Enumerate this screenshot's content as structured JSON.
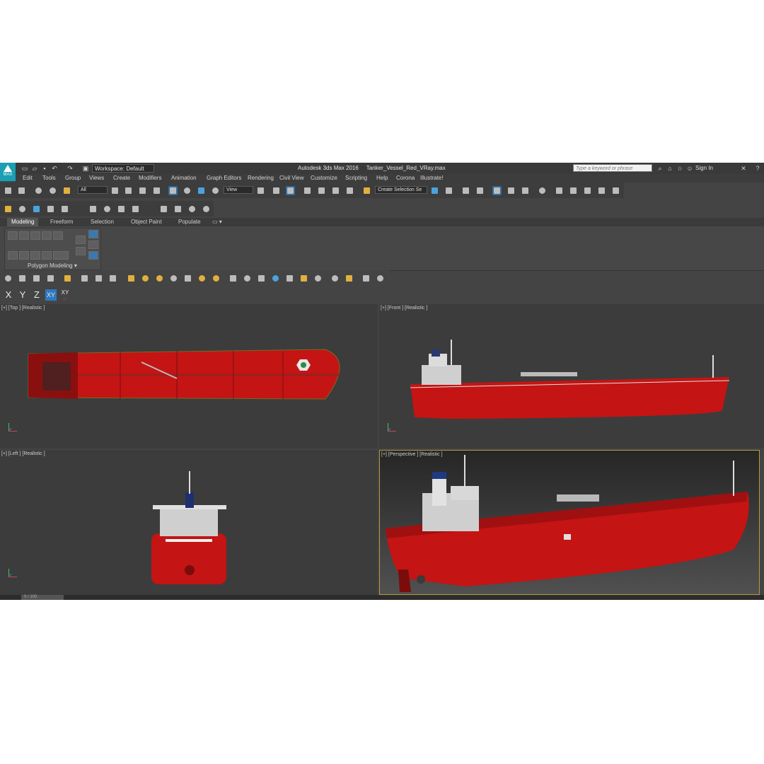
{
  "titlebar": {
    "logo_text": "MAX",
    "workspace": "Workspace: Default",
    "app_title": "Autodesk 3ds Max 2016     Tanker_Vessel_Red_VRay.max",
    "search_placeholder": "Type a keyword or phrase",
    "sign_in": "Sign In"
  },
  "menu": [
    "Edit",
    "Tools",
    "Group",
    "Views",
    "Create",
    "Modifiers",
    "Animation",
    "Graph Editors",
    "Rendering",
    "Civil View",
    "Customize",
    "Scripting",
    "Help",
    "Corona",
    "Illustrate!"
  ],
  "main_toolbar": {
    "selection_filter": "All",
    "reference_coord": "View",
    "named_selection": "Create Selection Se"
  },
  "ribbon": {
    "tabs": [
      "Modeling",
      "Freeform",
      "Selection",
      "Object Paint",
      "Populate"
    ],
    "active_tab": "Modeling",
    "panel_label": "Polygon Modeling"
  },
  "axis_constraints": [
    "X",
    "Y",
    "Z",
    "XY",
    "XY"
  ],
  "viewports": [
    {
      "label": "[+] [Top ] [Realistic ]"
    },
    {
      "label": "[+] [Front ] [Realistic ]"
    },
    {
      "label": "[+] [Left ] [Realistic ]"
    },
    {
      "label": "[+] [Perspective ] [Realistic ]"
    }
  ],
  "timeline": {
    "frame": "0 / 100"
  },
  "colors": {
    "hull_red": "#c41414",
    "ui_dark": "#444444",
    "active_blue": "#2f78c0",
    "persp_border": "#b69a3a"
  }
}
